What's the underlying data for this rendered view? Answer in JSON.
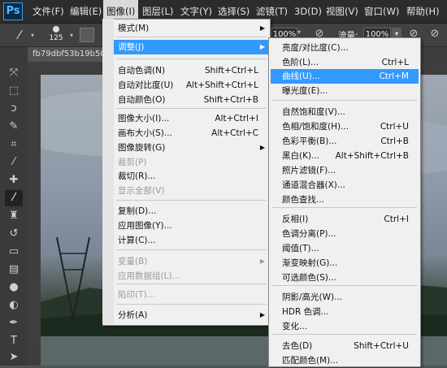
{
  "app": {
    "logo": "Ps"
  },
  "menubar": {
    "items": [
      {
        "label": "文件(F)"
      },
      {
        "label": "编辑(E)"
      },
      {
        "label": "图像(I)"
      },
      {
        "label": "图层(L)"
      },
      {
        "label": "文字(Y)"
      },
      {
        "label": "选择(S)"
      },
      {
        "label": "滤镜(T)"
      },
      {
        "label": "3D(D)"
      },
      {
        "label": "视图(V)"
      },
      {
        "label": "窗口(W)"
      },
      {
        "label": "帮助(H)"
      }
    ],
    "active_index": 2
  },
  "options_bar": {
    "brush_size": "125",
    "opacity_value": "100%",
    "flow_label": "流量:",
    "flow_value": "100%"
  },
  "document": {
    "tab_title": "fb79dbf53b19b50"
  },
  "image_menu": {
    "items": [
      {
        "label": "模式(M)",
        "shortcut": "",
        "submenu": true,
        "disabled": false,
        "highlight": false
      },
      {
        "label": "调整(J)",
        "shortcut": "",
        "submenu": true,
        "disabled": false,
        "highlight": true
      },
      {
        "label": "自动色调(N)",
        "shortcut": "Shift+Ctrl+L",
        "submenu": false,
        "disabled": false,
        "highlight": false
      },
      {
        "label": "自动对比度(U)",
        "shortcut": "Alt+Shift+Ctrl+L",
        "submenu": false,
        "disabled": false,
        "highlight": false
      },
      {
        "label": "自动颜色(O)",
        "shortcut": "Shift+Ctrl+B",
        "submenu": false,
        "disabled": false,
        "highlight": false
      },
      {
        "label": "图像大小(I)...",
        "shortcut": "Alt+Ctrl+I",
        "submenu": false,
        "disabled": false,
        "highlight": false
      },
      {
        "label": "画布大小(S)...",
        "shortcut": "Alt+Ctrl+C",
        "submenu": false,
        "disabled": false,
        "highlight": false
      },
      {
        "label": "图像旋转(G)",
        "shortcut": "",
        "submenu": true,
        "disabled": false,
        "highlight": false
      },
      {
        "label": "裁剪(P)",
        "shortcut": "",
        "submenu": false,
        "disabled": true,
        "highlight": false
      },
      {
        "label": "裁切(R)...",
        "shortcut": "",
        "submenu": false,
        "disabled": false,
        "highlight": false
      },
      {
        "label": "显示全部(V)",
        "shortcut": "",
        "submenu": false,
        "disabled": true,
        "highlight": false
      },
      {
        "label": "复制(D)...",
        "shortcut": "",
        "submenu": false,
        "disabled": false,
        "highlight": false
      },
      {
        "label": "应用图像(Y)...",
        "shortcut": "",
        "submenu": false,
        "disabled": false,
        "highlight": false
      },
      {
        "label": "计算(C)...",
        "shortcut": "",
        "submenu": false,
        "disabled": false,
        "highlight": false
      },
      {
        "label": "变量(B)",
        "shortcut": "",
        "submenu": true,
        "disabled": true,
        "highlight": false
      },
      {
        "label": "应用数据组(L)...",
        "shortcut": "",
        "submenu": false,
        "disabled": true,
        "highlight": false
      },
      {
        "label": "陷印(T)...",
        "shortcut": "",
        "submenu": false,
        "disabled": true,
        "highlight": false
      },
      {
        "label": "分析(A)",
        "shortcut": "",
        "submenu": true,
        "disabled": false,
        "highlight": false
      }
    ]
  },
  "adjust_menu": {
    "items": [
      {
        "label": "亮度/对比度(C)...",
        "shortcut": "",
        "highlight": false
      },
      {
        "label": "色阶(L)...",
        "shortcut": "Ctrl+L",
        "highlight": false
      },
      {
        "label": "曲线(U)...",
        "shortcut": "Ctrl+M",
        "highlight": true
      },
      {
        "label": "曝光度(E)...",
        "shortcut": "",
        "highlight": false
      },
      {
        "label": "自然饱和度(V)...",
        "shortcut": "",
        "highlight": false
      },
      {
        "label": "色相/饱和度(H)...",
        "shortcut": "Ctrl+U",
        "highlight": false
      },
      {
        "label": "色彩平衡(B)...",
        "shortcut": "Ctrl+B",
        "highlight": false
      },
      {
        "label": "黑白(K)...",
        "shortcut": "Alt+Shift+Ctrl+B",
        "highlight": false
      },
      {
        "label": "照片滤镜(F)...",
        "shortcut": "",
        "highlight": false
      },
      {
        "label": "通道混合器(X)...",
        "shortcut": "",
        "highlight": false
      },
      {
        "label": "颜色查找...",
        "shortcut": "",
        "highlight": false
      },
      {
        "label": "反相(I)",
        "shortcut": "Ctrl+I",
        "highlight": false
      },
      {
        "label": "色调分离(P)...",
        "shortcut": "",
        "highlight": false
      },
      {
        "label": "阈值(T)...",
        "shortcut": "",
        "highlight": false
      },
      {
        "label": "渐变映射(G)...",
        "shortcut": "",
        "highlight": false
      },
      {
        "label": "可选颜色(S)...",
        "shortcut": "",
        "highlight": false
      },
      {
        "label": "阴影/高光(W)...",
        "shortcut": "",
        "highlight": false
      },
      {
        "label": "HDR 色调...",
        "shortcut": "",
        "highlight": false
      },
      {
        "label": "变化...",
        "shortcut": "",
        "highlight": false
      },
      {
        "label": "去色(D)",
        "shortcut": "Shift+Ctrl+U",
        "highlight": false
      },
      {
        "label": "匹配颜色(M)...",
        "shortcut": "",
        "highlight": false
      }
    ]
  },
  "toolbox": {
    "tools": [
      {
        "name": "move-tool-icon"
      },
      {
        "name": "marquee-tool-icon"
      },
      {
        "name": "lasso-tool-icon"
      },
      {
        "name": "quick-select-tool-icon"
      },
      {
        "name": "crop-tool-icon"
      },
      {
        "name": "eyedropper-tool-icon"
      },
      {
        "name": "healing-brush-tool-icon"
      },
      {
        "name": "brush-tool-icon"
      },
      {
        "name": "clone-stamp-tool-icon"
      },
      {
        "name": "history-brush-tool-icon"
      },
      {
        "name": "eraser-tool-icon"
      },
      {
        "name": "gradient-tool-icon"
      },
      {
        "name": "blur-tool-icon"
      },
      {
        "name": "dodge-tool-icon"
      },
      {
        "name": "pen-tool-icon"
      },
      {
        "name": "type-tool-icon"
      },
      {
        "name": "path-select-tool-icon"
      }
    ]
  },
  "colors": {
    "highlight": "#3399ff",
    "menubar_bg": "#2c2c2c",
    "menu_bg": "#f0f0f0"
  }
}
